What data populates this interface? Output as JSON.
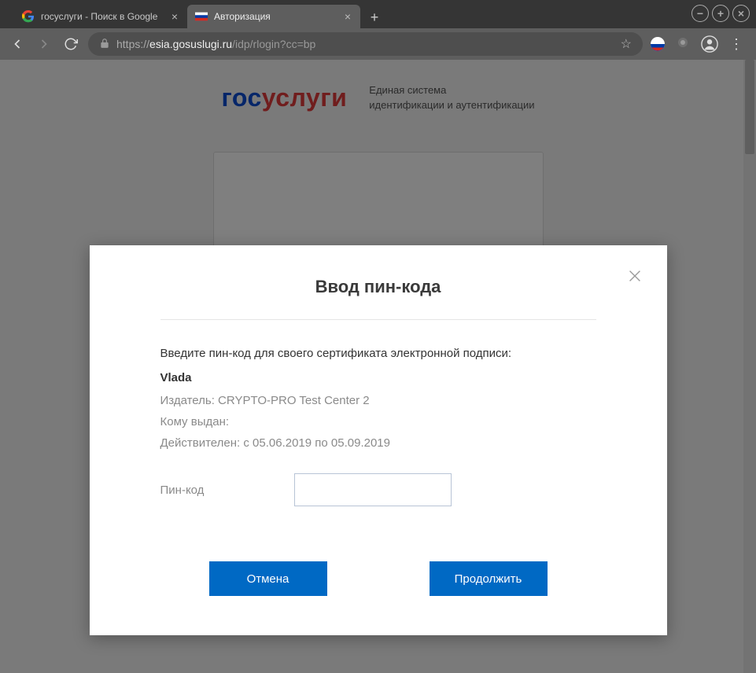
{
  "window_controls": {
    "minimize": "−",
    "maximize": "+",
    "close": "×"
  },
  "tabs": [
    {
      "title": "госуслуги - Поиск в Google",
      "active": false
    },
    {
      "title": "Авторизация",
      "active": true
    }
  ],
  "address": {
    "scheme": "https://",
    "domain": "esia.gosuslugi.ru",
    "path": "/idp/rlogin?cc=bp"
  },
  "logo": {
    "part1": "гос",
    "part2": "услуги"
  },
  "logo_subtitle_line1": "Единая система",
  "logo_subtitle_line2": "идентификации и аутентификации",
  "modal": {
    "title": "Ввод пин-кода",
    "instruction": "Введите пин-код для своего сертификата электронной подписи:",
    "cert_name": "Vlada",
    "issuer_label": "Издатель:",
    "issuer_value": "CRYPTO-PRO Test Center 2",
    "subject_label": "Кому выдан:",
    "subject_value": "",
    "validity_label": "Действителен:",
    "validity_value": "с 05.06.2019 по 05.09.2019",
    "pin_label": "Пин-код",
    "pin_value": "",
    "cancel": "Отмена",
    "continue": "Продолжить"
  }
}
